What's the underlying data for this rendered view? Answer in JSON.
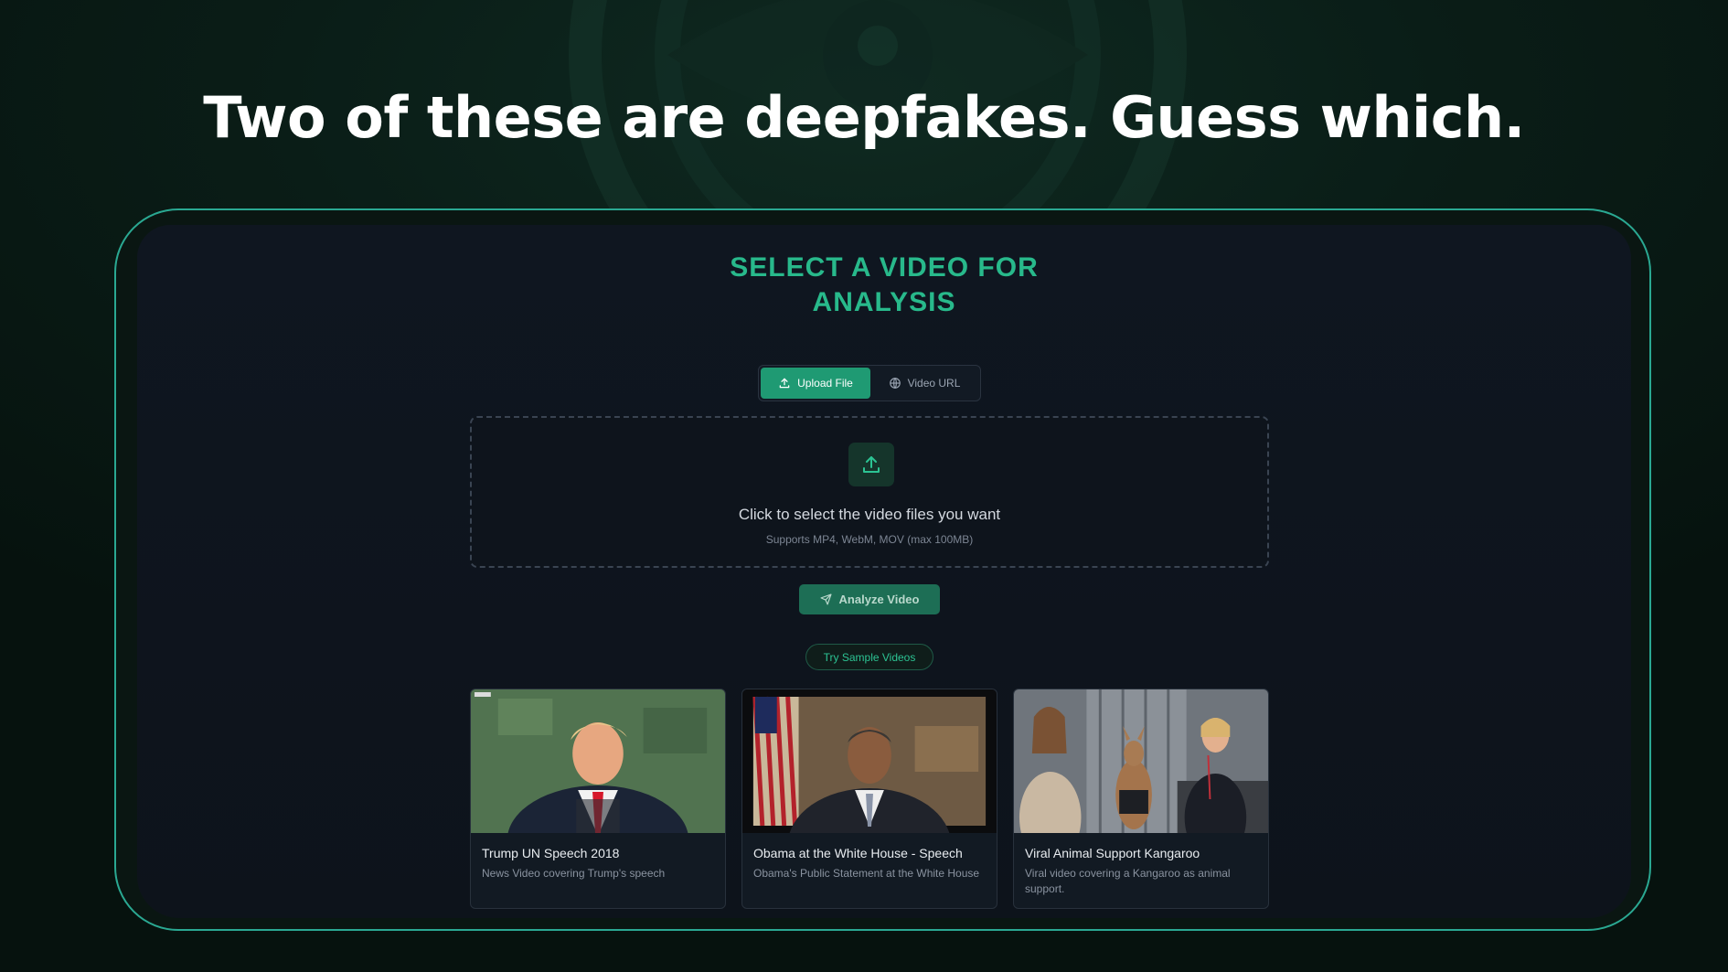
{
  "headline": "Two of these are deepfakes. Guess which.",
  "app": {
    "title_line1": "SELECT A VIDEO FOR",
    "title_line2": "ANALYSIS",
    "tabs": [
      {
        "label": "Upload File",
        "icon": "upload-icon",
        "active": true
      },
      {
        "label": "Video URL",
        "icon": "globe-icon",
        "active": false
      }
    ],
    "drop_zone": {
      "icon": "upload-icon",
      "title": "Click to select the video files you want",
      "subtitle": "Supports MP4, WebM, MOV (max 100MB)"
    },
    "analyze_label": "Analyze Video",
    "analyze_icon": "send-icon",
    "sample_label": "Try Sample Videos",
    "samples": [
      {
        "title": "Trump UN Speech 2018",
        "description": "News Video covering Trump's speech"
      },
      {
        "title": "Obama at the White House - Speech",
        "description": "Obama's Public Statement at the White House"
      },
      {
        "title": "Viral Animal Support Kangaroo",
        "description": "Viral video covering a Kangaroo as animal support."
      }
    ]
  },
  "colors": {
    "accent": "#28b98b",
    "frame_border": "#2aa892",
    "button": "#1d6e55",
    "tab_active": "#1f9a73"
  }
}
